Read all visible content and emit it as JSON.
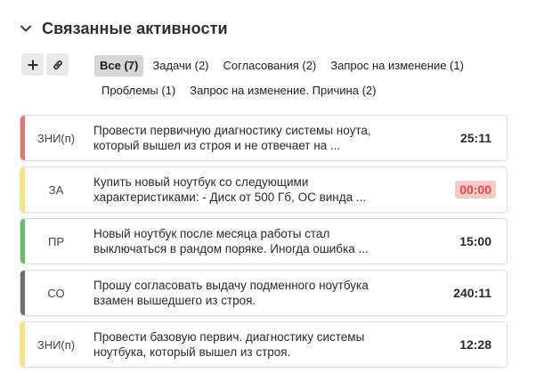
{
  "section": {
    "title": "Связанные активности",
    "collapse_icon": "chevron-down-icon"
  },
  "toolbar": {
    "add_icon": "plus-icon",
    "link_icon": "link-icon"
  },
  "filters": [
    {
      "label": "Все (7)",
      "active": true
    },
    {
      "label": "Задачи (2)",
      "active": false
    },
    {
      "label": "Согласования (2)",
      "active": false
    },
    {
      "label": "Запрос на изменение (1)",
      "active": false
    },
    {
      "label": "Проблемы (1)",
      "active": false
    },
    {
      "label": "Запрос на изменение. Причина (2)",
      "active": false
    }
  ],
  "activities": [
    {
      "code": "ЗНИ(п)",
      "color": "#e57373",
      "text": "Провести первичную диагностику системы ноута,\nкоторый вышел из строя и не отвечает на  ...",
      "time": "25:11",
      "overdue": false
    },
    {
      "code": "ЗА",
      "color": "#f7e27a",
      "text": "Купить новый ноутбук со следующими\nхарактеристиками: - Диск от 500 Гб, ОС винда ...",
      "time": "00:00",
      "overdue": true
    },
    {
      "code": "ПР",
      "color": "#66bb6a",
      "text": "Новый ноутбук после месяца работы стал\nвыключаться в рандом поряке. Иногда ошибка ...",
      "time": "15:00",
      "overdue": false
    },
    {
      "code": "СО",
      "color": "#6e6e6e",
      "text": "Прошу согласовать выдачу подменного ноутбука\nвзамен вышедшего из строя.",
      "time": "240:11",
      "overdue": false
    },
    {
      "code": "ЗНИ(п)",
      "color": "#f7e27a",
      "text": "Провести базовую первич. диагностику системы\nноутбука, который вышел из строя.",
      "time": "12:28",
      "overdue": false
    }
  ]
}
